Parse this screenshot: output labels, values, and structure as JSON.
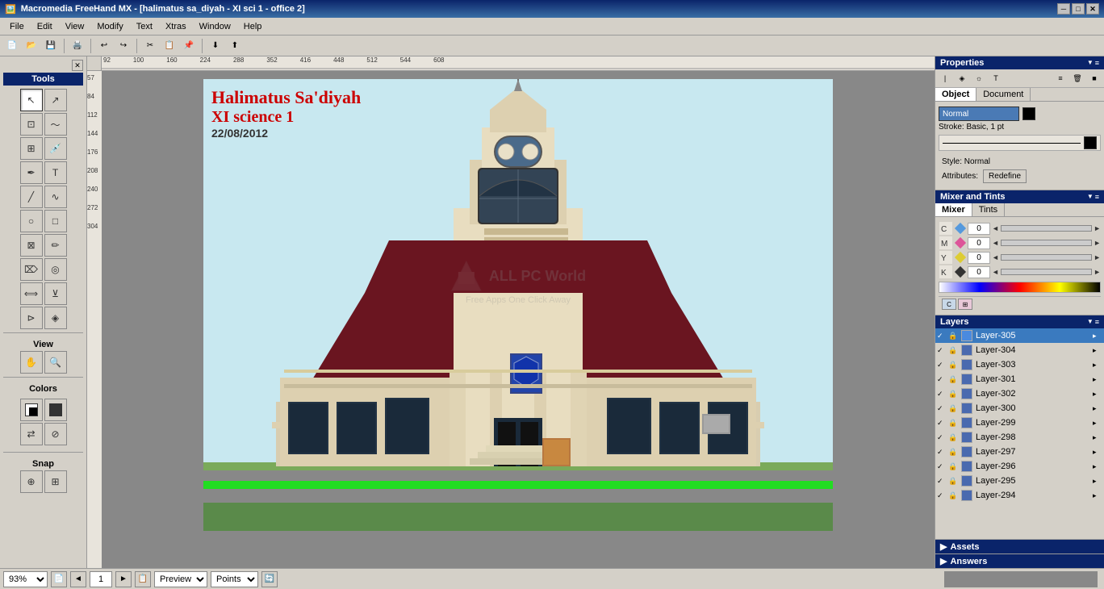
{
  "titlebar": {
    "title": "Macromedia FreeHand MX - [halimatus sa_diyah - XI sci 1 - office 2]",
    "icon": "🖼️",
    "btn_minimize": "─",
    "btn_restore": "□",
    "btn_close": "✕"
  },
  "menubar": {
    "items": [
      "File",
      "Edit",
      "View",
      "Modify",
      "Text",
      "Xtras",
      "Window",
      "Help"
    ]
  },
  "canvas": {
    "title_line1": "Halimatus Sa'diyah",
    "title_line2": "XI science 1",
    "date": "22/08/2012",
    "watermark_brand": "ALL PC World",
    "watermark_sub": "Free Apps One Click Away"
  },
  "tools": {
    "section_label": "Tools",
    "view_label": "View",
    "colors_label": "Colors",
    "snap_label": "Snap"
  },
  "properties": {
    "panel_title": "Properties",
    "tab_object": "Object",
    "tab_document": "Document",
    "style_name": "Normal",
    "stroke_info": "Stroke: Basic, 1 pt",
    "style_label": "Style: Normal",
    "attributes_label": "Attributes:",
    "redefine_btn": "Redefine"
  },
  "mixer": {
    "panel_title": "Mixer and Tints",
    "tab_mixer": "Mixer",
    "tab_tints": "Tints",
    "channel_c": "0",
    "channel_m": "0",
    "channel_y": "0",
    "channel_k": "0"
  },
  "layers": {
    "panel_title": "Layers",
    "items": [
      {
        "name": "Layer-305",
        "selected": true,
        "visible": true,
        "locked": false
      },
      {
        "name": "Layer-304",
        "selected": false,
        "visible": true,
        "locked": false
      },
      {
        "name": "Layer-303",
        "selected": false,
        "visible": true,
        "locked": false
      },
      {
        "name": "Layer-301",
        "selected": false,
        "visible": true,
        "locked": false
      },
      {
        "name": "Layer-302",
        "selected": false,
        "visible": true,
        "locked": false
      },
      {
        "name": "Layer-300",
        "selected": false,
        "visible": true,
        "locked": false
      },
      {
        "name": "Layer-299",
        "selected": false,
        "visible": true,
        "locked": false
      },
      {
        "name": "Layer-298",
        "selected": false,
        "visible": true,
        "locked": false
      },
      {
        "name": "Layer-297",
        "selected": false,
        "visible": true,
        "locked": false
      },
      {
        "name": "Layer-296",
        "selected": false,
        "visible": true,
        "locked": false
      },
      {
        "name": "Layer-295",
        "selected": false,
        "visible": true,
        "locked": false
      },
      {
        "name": "Layer-294",
        "selected": false,
        "visible": true,
        "locked": false
      }
    ]
  },
  "assets": {
    "panel_title": "Assets"
  },
  "answers": {
    "panel_title": "Answers"
  },
  "statusbar": {
    "zoom": "93%",
    "page": "1",
    "view_mode": "Preview",
    "units": "Points",
    "page_prev": "◄",
    "page_next": "►"
  }
}
